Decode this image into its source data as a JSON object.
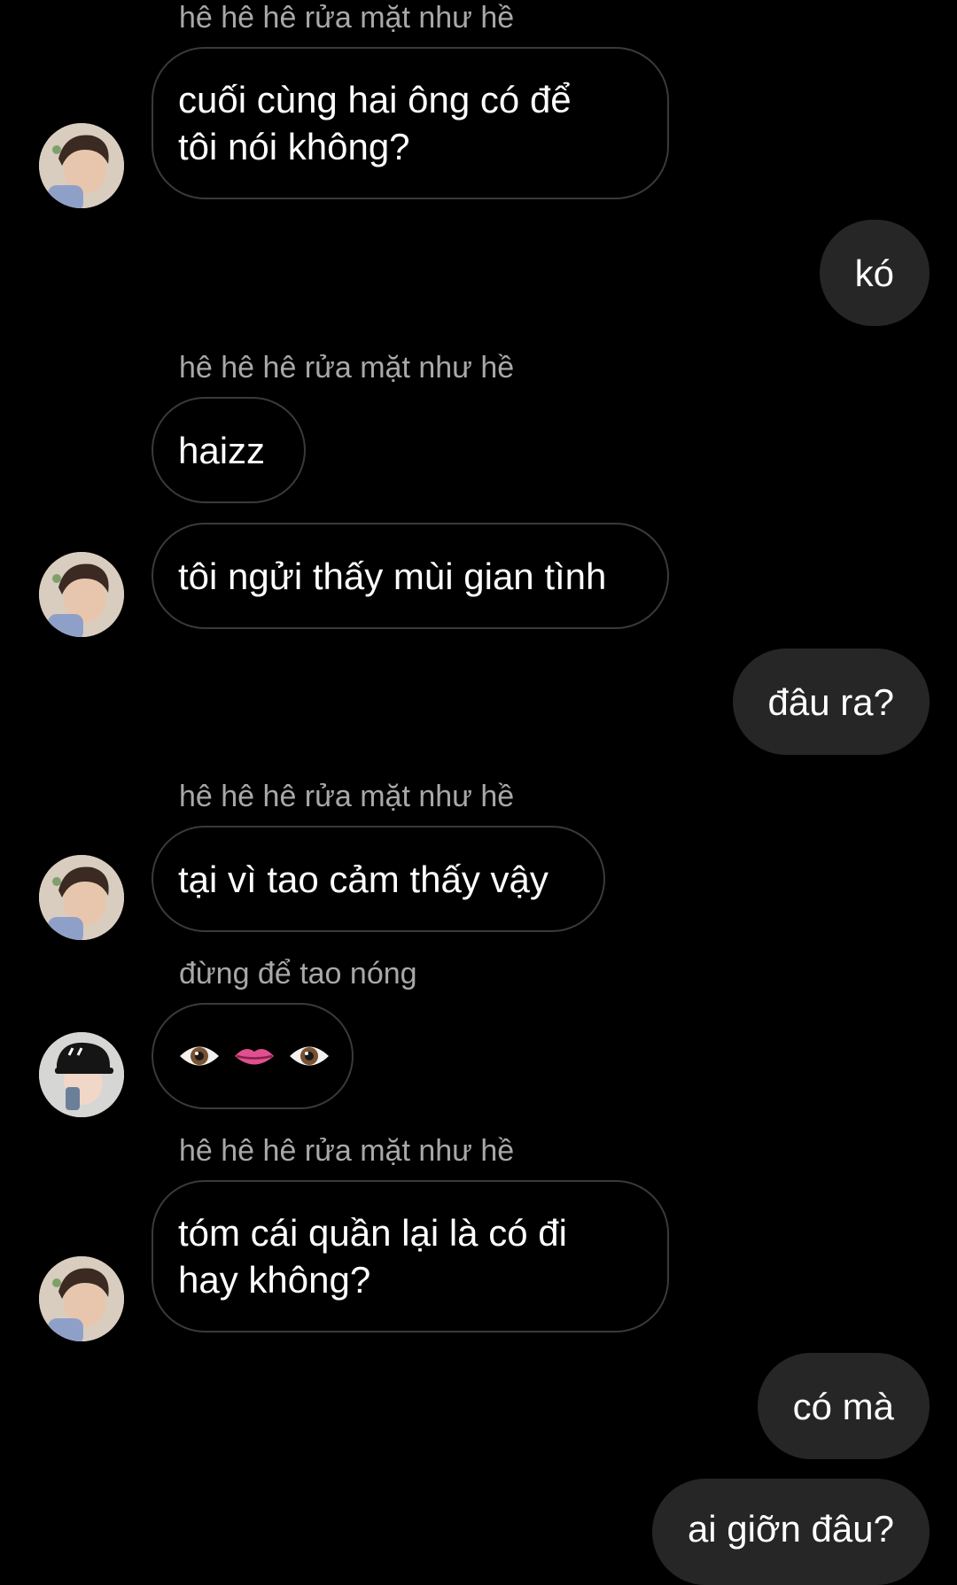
{
  "messages": [
    {
      "sender": "hê hê hê rửa mặt như hề",
      "text_lines": [
        "cuối cùng hai ông có để",
        "tôi nói không?"
      ]
    },
    {
      "text": "kó"
    },
    {
      "sender": "hê hê hê rửa mặt như hề",
      "text": "haizz"
    },
    {
      "text": "tôi ngửi thấy mùi gian tình"
    },
    {
      "text": "đâu ra?"
    },
    {
      "sender": "hê hê hê rửa mặt như hề",
      "text": "tại vì tao cảm thấy vậy"
    },
    {
      "sender": "đừng để tao nóng",
      "emojis": [
        "eye-emoji",
        "lips-emoji",
        "eye-emoji"
      ]
    },
    {
      "sender": "hê hê hê rửa mặt như hề",
      "text_lines": [
        "tóm cái quần lại là có đi",
        "hay không?"
      ]
    },
    {
      "text": "có mà"
    },
    {
      "text": "ai giỡn đâu?"
    }
  ],
  "colors": {
    "background": "#000000",
    "incoming_border": "#3a3a3a",
    "outgoing_bubble": "#262626",
    "sender_name": "#a8a8a8",
    "text": "#ffffff"
  }
}
